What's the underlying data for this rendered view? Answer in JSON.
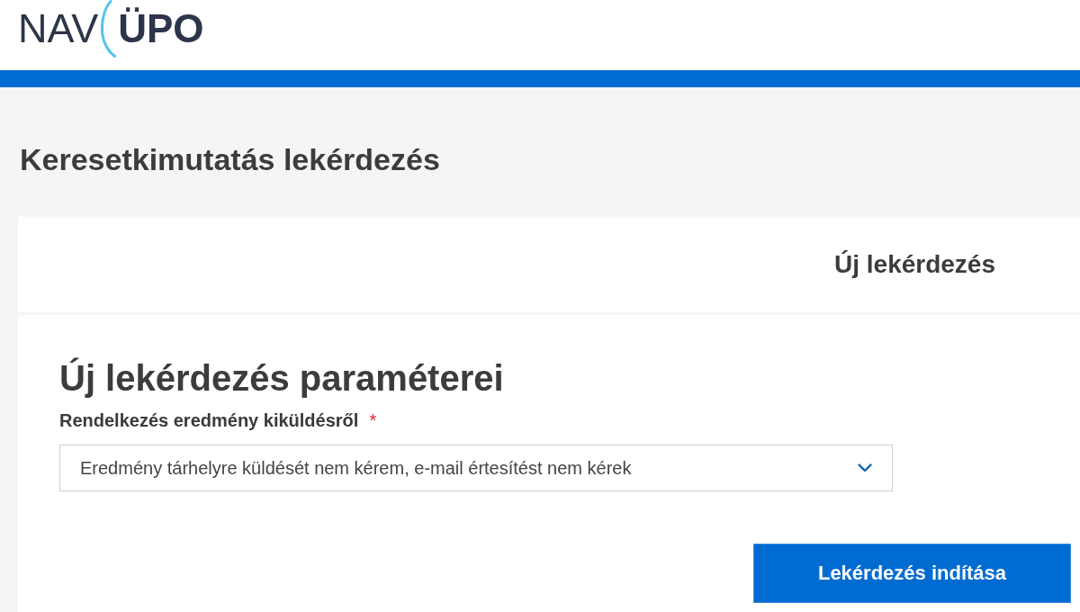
{
  "header": {
    "logo": {
      "left_text": "NAV",
      "right_text": "ÜPO"
    }
  },
  "page": {
    "title": "Keresetkimutatás lekérdezés"
  },
  "card": {
    "header_title": "Új lekérdezés",
    "section_title": "Új lekérdezés paraméterei",
    "field": {
      "label": "Rendelkezés eredmény kiküldésről",
      "required_mark": "*",
      "value": "Eredmény tárhelyre küldését nem kérem, e-mail értesítést nem kérek"
    },
    "button": "Lekérdezés indítása"
  }
}
